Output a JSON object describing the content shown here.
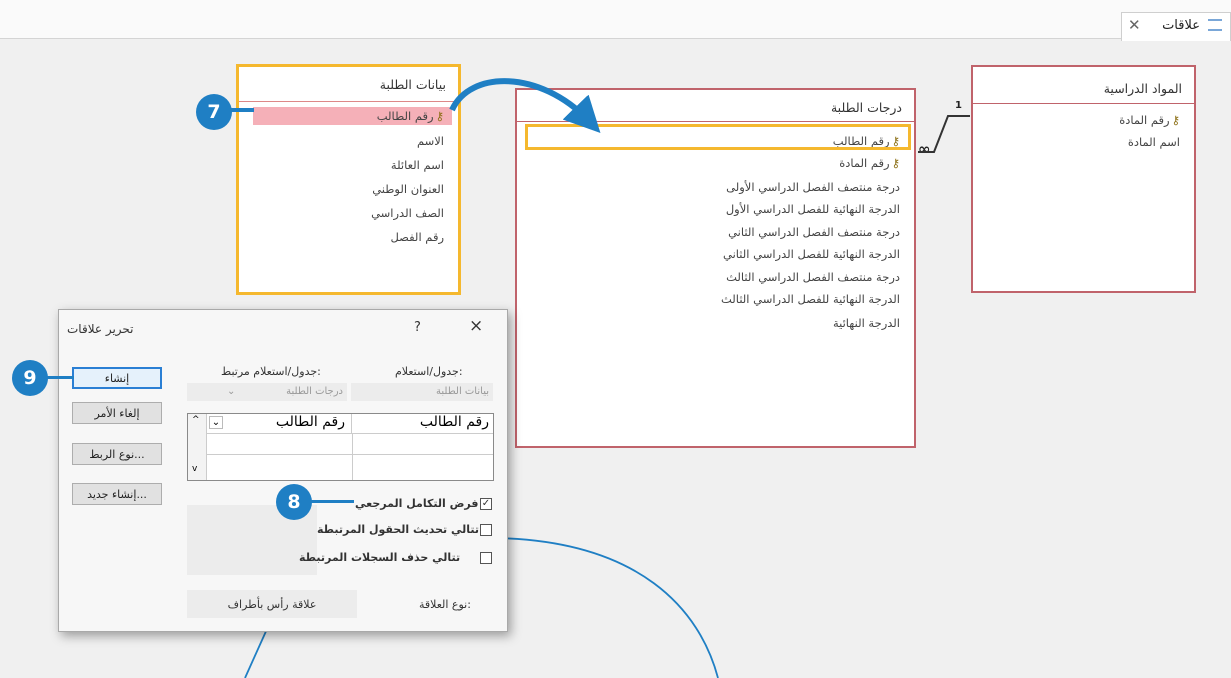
{
  "document_tab": {
    "label": "علاقات"
  },
  "tables": {
    "students": {
      "title": "بيانات الطلبة",
      "fields": [
        "رقم الطالب",
        "الاسم",
        "اسم العائلة",
        "العنوان الوطني",
        "الصف الدراسي",
        "رقم الفصل"
      ]
    },
    "grades": {
      "title": "درجات الطلبة",
      "fields": [
        "رقم الطالب",
        "رقم المادة",
        "درجة منتصف الفصل الدراسي الأولى",
        "الدرجة النهائية للفصل الدراسي الأول",
        "درجة منتصف الفصل الدراسي الثاني",
        "الدرجة النهائية للفصل الدراسي الثاني",
        "درجة منتصف الفصل الدراسي الثالث",
        "الدرجة النهائية للفصل الدراسي الثالث",
        "الدرجة النهائية"
      ]
    },
    "subjects": {
      "title": "المواد الدراسية",
      "fields": [
        "رقم المادة",
        "اسم المادة"
      ]
    }
  },
  "relationship": {
    "one_label": "1",
    "many_label": "∞"
  },
  "callouts": {
    "c7": "7",
    "c8": "8",
    "c9": "9"
  },
  "dialog": {
    "title": "تحرير علاقات",
    "help": "?",
    "close": "×",
    "table_label": "جدول/استعلام:",
    "related_label": "جدول/استعلام مرتبط:",
    "table_value": "بيانات الطلبة",
    "related_value": "درجات الطلبة",
    "grid_left_field": "رقم الطالب",
    "grid_right_field": "رقم الطالب",
    "buttons": {
      "create": "إنشاء",
      "cancel": "إلغاء الأمر",
      "join_type": "نوع الربط...",
      "create_new": "إنشاء جديد..."
    },
    "checks": {
      "enforce": "فرض التكامل المرجعي",
      "cascade_update": "تتالي تحديث الحقول المرتبطة",
      "cascade_delete": "تتالي حذف السجلات المرتبطة"
    },
    "checked": {
      "enforce": true,
      "cascade_update": false,
      "cascade_delete": false
    },
    "rel_type_label": "نوع العلاقة:",
    "rel_type_value": "علاقة رأس بأطراف"
  },
  "colors": {
    "callout": "#1f7fc4",
    "highlight": "#f5b82e",
    "table_border": "#c0636b",
    "selected_row": "#f5b0b8"
  }
}
